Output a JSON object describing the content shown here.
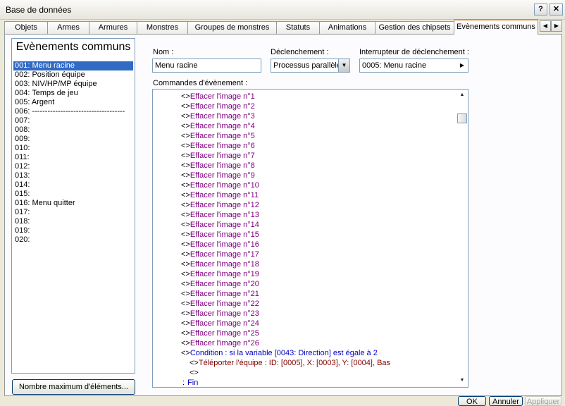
{
  "window": {
    "title": "Base de données",
    "help_label": "?",
    "close_label": "✕"
  },
  "tabs": [
    "Objets",
    "Armes",
    "Armures",
    "Monstres",
    "Groupes de monstres",
    "Statuts",
    "Animations",
    "Gestion des chipsets",
    "Evènements communs"
  ],
  "tab_arrows": {
    "left": "◀",
    "right": "▶"
  },
  "left_panel": {
    "title": "Evènements communs",
    "items": [
      "001: Menu racine",
      "002: Position équipe",
      "003: NIV/HP/MP équipe",
      "004: Temps de jeu",
      "005: Argent",
      "006: ------------------------------------",
      "007:",
      "008:",
      "009:",
      "010:",
      "011:",
      "012:",
      "013:",
      "014:",
      "015:",
      "016: Menu quitter",
      "017:",
      "018:",
      "019:",
      "020:"
    ],
    "max_button": "Nombre maximum d'éléments..."
  },
  "form": {
    "name_label": "Nom :",
    "name_value": "Menu racine",
    "trigger_label": "Déclenchement :",
    "trigger_value": "Processus parallèle",
    "switch_label": "Interrupteur de déclenchement :",
    "switch_value": "0005: Menu racine",
    "commands_label": "Commandes d'évènement :"
  },
  "commands": [
    {
      "marker": "<>",
      "text": "Effacer l'image n°1",
      "kind": "erase"
    },
    {
      "marker": "<>",
      "text": "Effacer l'image n°2",
      "kind": "erase"
    },
    {
      "marker": "<>",
      "text": "Effacer l'image n°3",
      "kind": "erase"
    },
    {
      "marker": "<>",
      "text": "Effacer l'image n°4",
      "kind": "erase"
    },
    {
      "marker": "<>",
      "text": "Effacer l'image n°5",
      "kind": "erase"
    },
    {
      "marker": "<>",
      "text": "Effacer l'image n°6",
      "kind": "erase"
    },
    {
      "marker": "<>",
      "text": "Effacer l'image n°7",
      "kind": "erase"
    },
    {
      "marker": "<>",
      "text": "Effacer l'image n°8",
      "kind": "erase"
    },
    {
      "marker": "<>",
      "text": "Effacer l'image n°9",
      "kind": "erase"
    },
    {
      "marker": "<>",
      "text": "Effacer l'image n°10",
      "kind": "erase"
    },
    {
      "marker": "<>",
      "text": "Effacer l'image n°11",
      "kind": "erase"
    },
    {
      "marker": "<>",
      "text": "Effacer l'image n°12",
      "kind": "erase"
    },
    {
      "marker": "<>",
      "text": "Effacer l'image n°13",
      "kind": "erase"
    },
    {
      "marker": "<>",
      "text": "Effacer l'image n°14",
      "kind": "erase"
    },
    {
      "marker": "<>",
      "text": "Effacer l'image n°15",
      "kind": "erase"
    },
    {
      "marker": "<>",
      "text": "Effacer l'image n°16",
      "kind": "erase"
    },
    {
      "marker": "<>",
      "text": "Effacer l'image n°17",
      "kind": "erase"
    },
    {
      "marker": "<>",
      "text": "Effacer l'image n°18",
      "kind": "erase"
    },
    {
      "marker": "<>",
      "text": "Effacer l'image n°19",
      "kind": "erase"
    },
    {
      "marker": "<>",
      "text": "Effacer l'image n°20",
      "kind": "erase"
    },
    {
      "marker": "<>",
      "text": "Effacer l'image n°21",
      "kind": "erase"
    },
    {
      "marker": "<>",
      "text": "Effacer l'image n°22",
      "kind": "erase"
    },
    {
      "marker": "<>",
      "text": "Effacer l'image n°23",
      "kind": "erase"
    },
    {
      "marker": "<>",
      "text": "Effacer l'image n°24",
      "kind": "erase"
    },
    {
      "marker": "<>",
      "text": "Effacer l'image n°25",
      "kind": "erase"
    },
    {
      "marker": "<>",
      "text": "Effacer l'image n°26",
      "kind": "erase"
    },
    {
      "marker": "<>",
      "text": "Condition : si la variable [0043: Direction] est égale à 2",
      "kind": "cond"
    },
    {
      "marker": "<>",
      "text": "Téléporter l'équipe : ID: [0005], X: [0003], Y: [0004], Bas",
      "kind": "tele"
    },
    {
      "marker": "<>",
      "text": "",
      "kind": "plain"
    },
    {
      "marker": ":",
      "text": "Fin",
      "kind": "fin"
    }
  ],
  "scroll": {
    "up": "▲",
    "down": "▼"
  },
  "buttons": {
    "ok": "OK",
    "cancel": "Annuler",
    "apply": "Appliquer"
  }
}
